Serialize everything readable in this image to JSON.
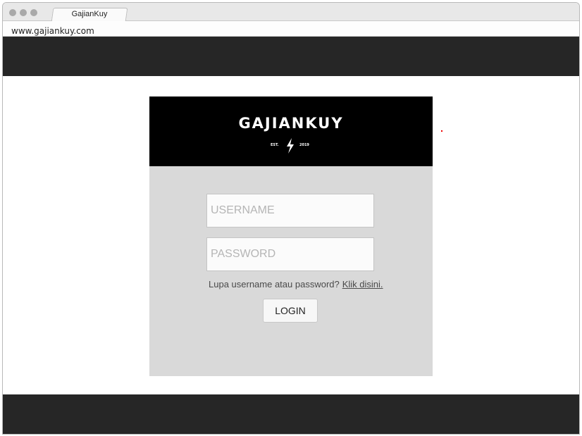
{
  "browser": {
    "tab_title": "GajianKuy",
    "url": "www.gajiankuy.com"
  },
  "login": {
    "logo_text": "GAJIANKUY",
    "logo_est": "EST.",
    "logo_year": "2019",
    "username_placeholder": "USERNAME",
    "password_placeholder": "PASSWORD",
    "forgot_text": "Lupa username atau password?",
    "forgot_link": "Klik disini.",
    "login_label": "LOGIN"
  },
  "colors": {
    "header_band": "#262626",
    "logo_bg": "#000000",
    "card_bg": "#d9d9d9"
  }
}
